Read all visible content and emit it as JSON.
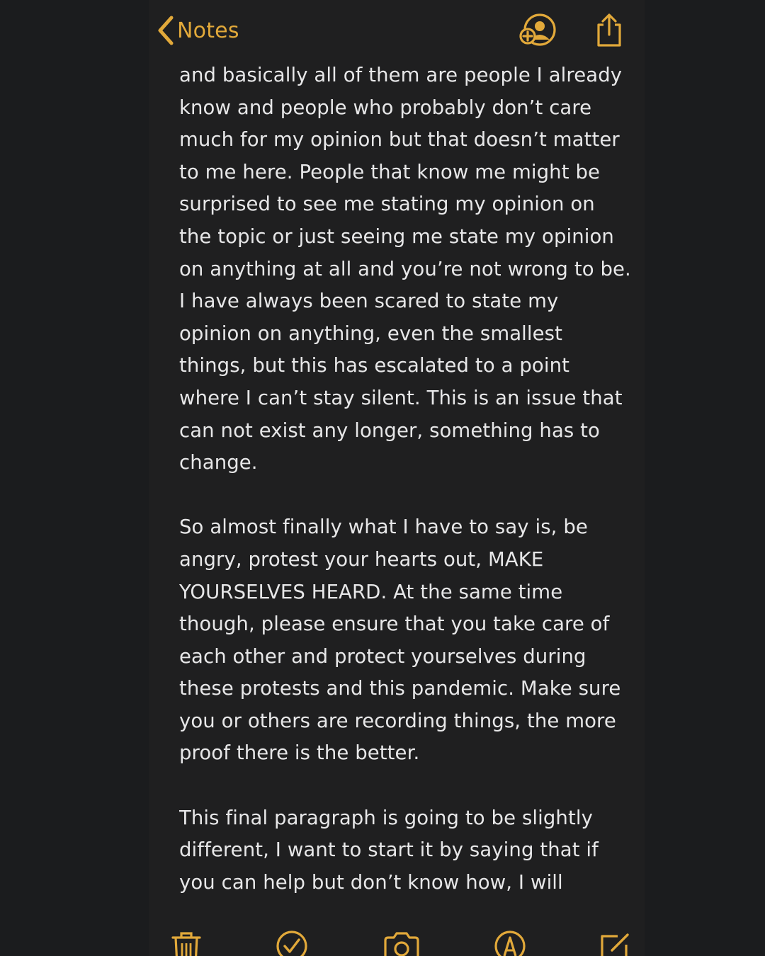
{
  "app": {
    "name": "Notes",
    "accent_color": "#e2a93a",
    "background_color": "#1f1f20",
    "text_color": "#e7e7e8"
  },
  "navbar": {
    "back_label": "Notes",
    "back_icon": "chevron-left-icon",
    "actions": [
      {
        "name": "add-people-button",
        "icon": "person-add-icon"
      },
      {
        "name": "share-button",
        "icon": "share-icon"
      }
    ]
  },
  "note": {
    "paragraphs": [
      "and basically all of them are people I already know and people who probably don’t care much for my opinion but that doesn’t matter to me here. People that know me might be surprised to see me stating my opinion on the topic or just seeing me state my opinion on anything at all and you’re not wrong to be. I have always been scared to state my opinion on anything, even the smallest things, but this has escalated to a point where I can’t stay silent. This is an issue that can not exist any longer, something has to change.",
      "So almost finally what I have to say is, be angry, protest your hearts out, MAKE YOURSELVES HEARD. At the same time though, please ensure that you take care of each other and protect yourselves during these protests and this pandemic. Make sure you or others are recording things, the more proof there is the better.",
      "This final paragraph is going to be slightly different, I want to start it by saying that if you can help but don’t know how, I will"
    ]
  },
  "toolbar": {
    "items": [
      {
        "name": "delete-button",
        "icon": "trash-icon"
      },
      {
        "name": "checklist-button",
        "icon": "checkmark-circle-icon"
      },
      {
        "name": "camera-button",
        "icon": "camera-icon"
      },
      {
        "name": "markup-button",
        "icon": "pen-tip-icon"
      },
      {
        "name": "compose-button",
        "icon": "compose-icon"
      }
    ]
  }
}
